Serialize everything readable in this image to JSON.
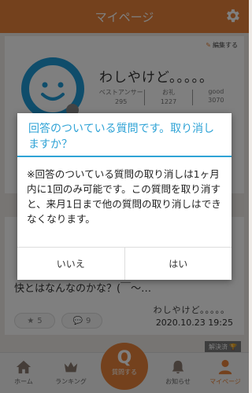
{
  "header": {
    "title": "マイページ",
    "gear_icon": "gear-icon"
  },
  "profile": {
    "edit_label": "編集する",
    "username": "わしやけど。。。。。",
    "stats": [
      {
        "label": "ベストアンサー",
        "value": "295"
      },
      {
        "label": "お礼",
        "value": "1227"
      },
      {
        "label": "good",
        "value": "3070"
      }
    ]
  },
  "question": {
    "text": "快とはなんなのかな？(￣～…",
    "author": "わしやけど。。。。。",
    "date": "2020.10.23 19:25",
    "stars": "5",
    "comments": "9",
    "resolved_label": "解決済"
  },
  "dialog": {
    "title": "回答のついている質問です。取り消しますか？",
    "body": "※回答のついている質問の取り消しは1ヶ月内に1回のみ可能です。この質問を取り消すと、来月1日まで他の質問の取り消しはできなくなります。",
    "cancel_label": "いいえ",
    "confirm_label": "はい"
  },
  "nav": {
    "home": "ホーム",
    "ranking": "ランキング",
    "ask": "質問する",
    "ask_glyph": "Q",
    "notice": "お知らせ",
    "mypage": "マイページ"
  },
  "colors": {
    "accent": "#e8833a",
    "dialog_title": "#2fa3d6"
  }
}
